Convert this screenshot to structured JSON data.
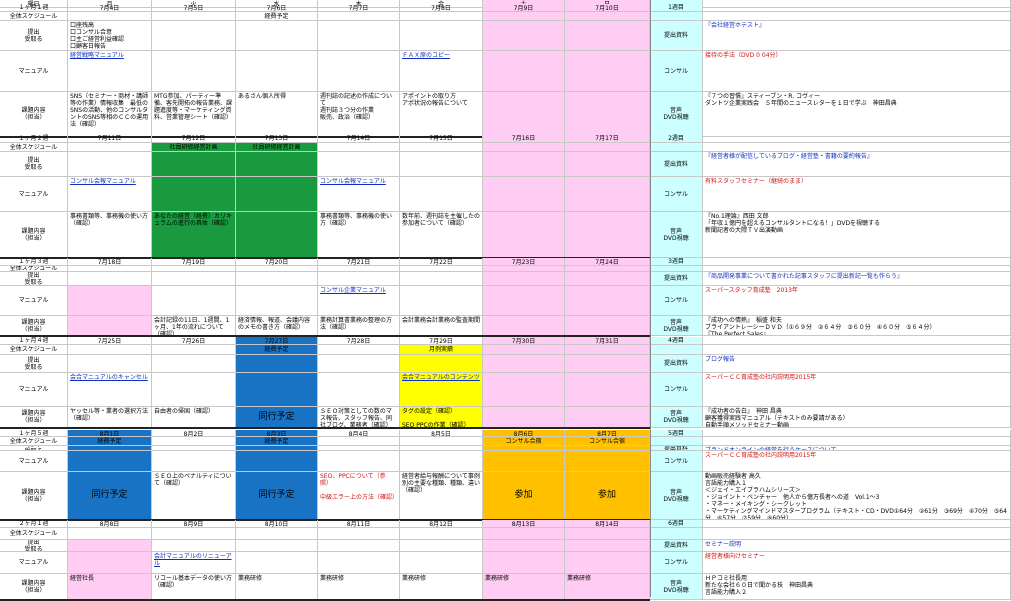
{
  "colors": {
    "green": "#1a9a3f",
    "blue": "#1873c5",
    "pink": "#ffccf3",
    "yellow": "#ffff00",
    "orange": "#ffc000",
    "cyan": "#ccffff",
    "link": "#1030c0",
    "red": "#d01010"
  },
  "header": {
    "corner": "曜日",
    "days": [
      "月",
      "火",
      "水",
      "木",
      "金",
      "土",
      "日"
    ]
  },
  "labels": {
    "schedule": "全体スケジュール",
    "submit": "提出\n受取る",
    "manual": "マニュアル",
    "content": "課題内容\n（担当）",
    "side_submit": "提出資料",
    "side_consult": "コンサル",
    "side_dvd": "音声\nDVD視聴"
  },
  "weeks": [
    {
      "week_label": "１ヶ月１週",
      "dates": [
        "7月4日",
        "7月5日",
        "7月6日",
        "7月7日",
        "7月8日",
        "7月9日",
        "7月10日"
      ],
      "schedule": [
        "",
        "",
        "経費予定",
        "",
        "",
        "",
        ""
      ],
      "submit": [
        "口座残高\n口コンサル合意\n口主ご経営利益確認\n口顧客日報告",
        "",
        "",
        "",
        "",
        "",
        ""
      ],
      "manual": [
        "経営戦略マニュアル",
        "",
        "",
        "",
        "ＦＡＸ原のコピー",
        "",
        ""
      ],
      "content": [
        "SNS（セミナー・商材・講師等の作業）情報収集　最低のSNSの活動、他のコンサルタントのSNS等相のＣＣの運用法（確認）",
        "MTG参加、パーティー準備、客先開拓の報告業務、課題進度等・マーケティング資料、営業管理シート（確認）",
        "あるさん個人所得",
        "週刊誌の記述の作成について\n週刊誌３つ分の作業\n販売、政治（確認）",
        "アポイントの取り方\nアポ状況の報告について",
        "",
        ""
      ],
      "side_num": "1週目",
      "side_submit": "『会社経営ホテスト』",
      "side_consult": "接待の手法（DVD 0 04分）",
      "side_dvd": "『７つの習慣』スティーブン・R. コヴィー\nダントツ企業実践会　５年間のニュースレターを１日で学ぶ　神田昌典"
    },
    {
      "week_label": "１ヶ月２週",
      "dates": [
        "7月11日",
        "7月12日",
        "7月13日",
        "7月14日",
        "7月15日",
        "7月16日",
        "7月17日"
      ],
      "schedule": [
        "",
        "社員研修経営計画",
        "社員研修経営計画",
        "",
        "",
        "",
        ""
      ],
      "submit": [
        "",
        "",
        "",
        "",
        "",
        "",
        ""
      ],
      "manual": [
        "コンサル会報マニュアル",
        "",
        "",
        "コンサル会報マニュアル",
        "",
        "",
        ""
      ],
      "content": [
        "事務書類等、事務機の使い方（確認）",
        "あなたの経営（経費）カリキュラムの進行の具体（確認）",
        "",
        "事務書類等、事務機の使い方（確認）",
        "数年前、週刊誌を主催したの参加者について（確認）",
        "",
        ""
      ],
      "side_num": "2週目",
      "side_submit": "『経営者様が配信しているブログ・経営塾・書籍の要約報告』",
      "side_consult": "有料スタッフセミナー（継続のまま）",
      "side_dvd": "『No.1理論』西田 文郎\n「年収１億円を超えるコンサルタントになる！」DVDを視聴する\n新聞記者の大隈ＴＶ出演動画"
    },
    {
      "week_label": "１ヶ月３週",
      "dates": [
        "7月18日",
        "7月19日",
        "7月20日",
        "7月21日",
        "7月22日",
        "7月23日",
        "7月24日"
      ],
      "schedule": [
        "",
        "",
        "",
        "",
        "",
        "",
        ""
      ],
      "submit": [
        "",
        "",
        "",
        "",
        "",
        "",
        ""
      ],
      "manual": [
        "",
        "",
        "",
        "コンサル企業マニュアル",
        "",
        "",
        ""
      ],
      "content": [
        "",
        "会計記録の11日、1週間、1ヶ月、1年の流れについて（確認）",
        "経済情報、報道、会議内容のメモの書き方（確認）",
        "業務計算書業務の整理の方法（確認）",
        "会計業務会計業務の監査期間",
        "",
        ""
      ],
      "side_num": "3週目",
      "side_submit": "『商品開発事業について書かれた記事スタッフに提出新記一覧も作らう』",
      "side_consult": "スーパースタッフ育成塾　2013年",
      "side_dvd": "『成功への情熱』　稲盛 和夫\nブライアントレーシーＤＶＤ（①６９分　②６４分　③６０分　④６０分　⑤６４分）\n『The Perfect Sales』\n管理業務研修日"
    },
    {
      "week_label": "１ヶ月４週",
      "dates": [
        "7月25日",
        "7月26日",
        "7月27日",
        "7月28日",
        "7月29日",
        "7月30日",
        "7月31日"
      ],
      "schedule": [
        "",
        "",
        "経費予定",
        "",
        "月例実績",
        "",
        ""
      ],
      "submit": [
        "",
        "",
        "",
        "",
        "",
        "",
        ""
      ],
      "manual": [
        "会合マニュアルのキャンセル",
        "",
        "",
        "",
        "会合マニュアルのコンテンツ",
        "",
        ""
      ],
      "content": [
        "ヤッセル等・業者の選択方法（確認）",
        "自由者の帰国（確認）",
        "同行予定",
        "ＳＥＯ対策としての数のマス報告、スタッフ報告、同社ブログ、業務者（確認）",
        "タグの設定（確認）\n\nSEO PPCの作業（確認）",
        "",
        ""
      ],
      "side_num": "4週目",
      "side_submit": "ブログ報告",
      "side_consult": "スーパーＣＣ育成塾の社内説明用2015年",
      "side_dvd": "『成功者の告白』　神田 昌典\n顧客獲得実践マニュアル（テキストのみ要請がある）\n自動手順メソッドセミナー動画\n小規模セミナー動画"
    },
    {
      "week_label": "１ヶ月５週",
      "dates": [
        "8月1日",
        "8月2日",
        "8月3日",
        "8月4日",
        "8月5日",
        "8月6日",
        "8月7日"
      ],
      "schedule": [
        "経費予定",
        "",
        "経費予定",
        "",
        "",
        "コンサル合宿",
        "コンサル合宿"
      ],
      "submit": [
        "",
        "",
        "",
        "",
        "",
        "",
        ""
      ],
      "manual": [
        "",
        "",
        "",
        "",
        "",
        "",
        ""
      ],
      "content": [
        "同行予定",
        "ＳＥＯ上のペナルティについて（確認）",
        "同行予定",
        "SEO、PPCについて（参照）\n\n中級エラー上の方法（確認）",
        "経営者給与報酬について事例別の主要な種類、種類、違い（確認）",
        "参加",
        "参加"
      ],
      "side_num": "5週目",
      "side_submit": "ブランドオンラインの経営を行うケースについて",
      "side_consult": "スーパーＣＣ育成塾の社内説明用2015年",
      "side_dvd": "動画販売経験者 高久\n言語能力購入１\n＜ジェイ・エイブラハムシリーズ＞\n・ジョイント・ベンチャー　他人から億万長者への道　Vol.1～3\n・マネー・メイキング・シークレット\n・マーケティングマインドマスタープログラム（テキスト・CD・DVD①64分　②61分　③69分　④70分　⑤64分　⑥57分　⑦59分　⑧60分）"
    },
    {
      "week_label": "２ヶ月１週",
      "dates": [
        "8月8日",
        "8月9日",
        "8月10日",
        "8月11日",
        "8月12日",
        "8月13日",
        "8月14日"
      ],
      "schedule": [
        "",
        "",
        "",
        "",
        "",
        "",
        ""
      ],
      "submit": [
        "",
        "",
        "",
        "",
        "",
        "",
        ""
      ],
      "manual": [
        "",
        "会計マニュアルのリニューアル",
        "",
        "",
        "",
        "",
        ""
      ],
      "content": [
        "経営社長",
        "リコール基本データの使い方（確認）",
        "業務研修",
        "業務研修",
        "業務研修",
        "業務研修",
        "業務研修"
      ],
      "side_num": "6週目",
      "side_submit": "セミナー説明",
      "side_consult": "経営者様向けセミナー",
      "side_dvd": "ＨＰコミ社長用\n新たな会社６０日で聞かる技　神田昌典\n言語能力購入２"
    }
  ]
}
